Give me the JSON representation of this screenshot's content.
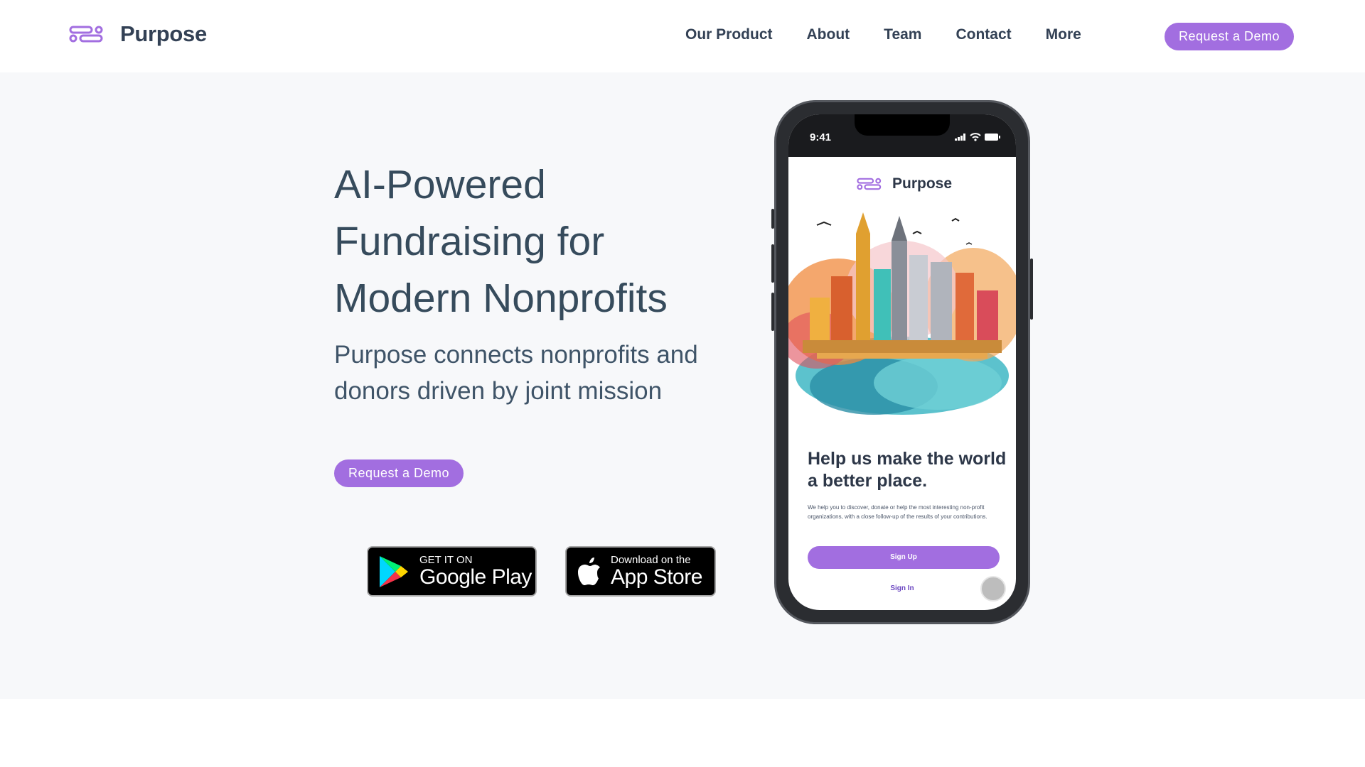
{
  "brand": {
    "name": "Purpose",
    "accent": "#a26ee0",
    "text_color": "#334155"
  },
  "nav": {
    "items": [
      {
        "label": "Our Product"
      },
      {
        "label": "About"
      },
      {
        "label": "Team"
      },
      {
        "label": "Contact"
      },
      {
        "label": "More"
      }
    ],
    "cta_label": "Request a Demo"
  },
  "hero": {
    "headline": "AI-Powered Fundraising for Modern Nonprofits",
    "subheadline": "Purpose connects nonprofits and donors driven by joint mission",
    "cta_label": "Request a Demo",
    "badges": {
      "google": {
        "small": "GET IT ON",
        "big": "Google Play",
        "icon": "google-play-icon"
      },
      "apple": {
        "small": "Download on the",
        "big": "App Store",
        "icon": "apple-icon"
      }
    }
  },
  "phone": {
    "time": "9:41",
    "app_name": "Purpose",
    "title": "Help us make the world a better place.",
    "description": "We help you to discover, donate or help the most interesting non-profit organizations, with a close follow-up of the results of your contributions.",
    "signup_label": "Sign Up",
    "signin_label": "Sign In"
  }
}
